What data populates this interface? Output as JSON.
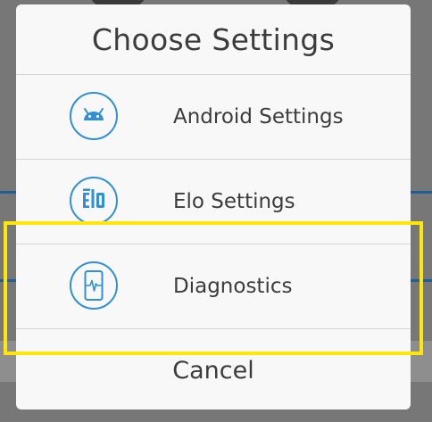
{
  "dialog": {
    "title": "Choose Settings",
    "options": [
      {
        "label": "Android Settings",
        "icon": "android-icon"
      },
      {
        "label": "Elo Settings",
        "icon": "elo-logo-icon"
      },
      {
        "label": "Diagnostics",
        "icon": "diagnostics-icon"
      }
    ],
    "cancel_label": "Cancel"
  },
  "colors": {
    "accent": "#2f8fd8",
    "highlight": "#ffe60a",
    "dialog_background": "#f8f8f8",
    "text": "#3c3c3c"
  },
  "highlight": {
    "target": "Diagnostics"
  }
}
